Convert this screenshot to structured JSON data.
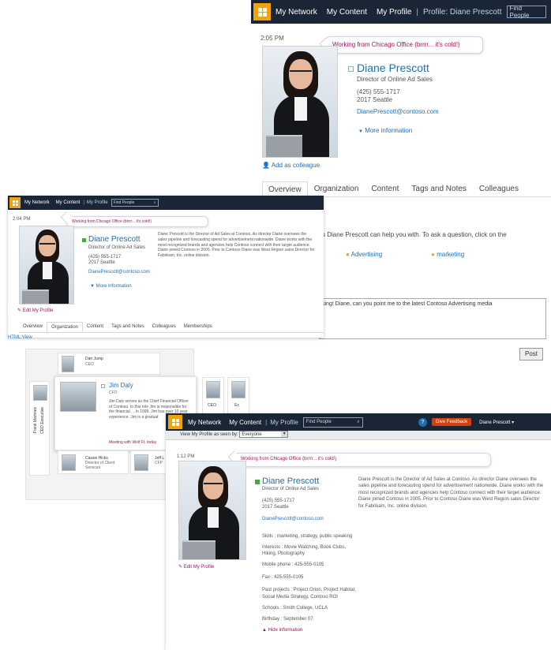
{
  "brand_colors": {
    "topbar": "#1a2636",
    "logo": "#f0a30a",
    "link": "#1e6fb5",
    "status": "#a3125a",
    "feedback": "#d5400f"
  },
  "win1": {
    "nav": {
      "my_network": "My Network",
      "my_content": "My Content",
      "my_profile": "My Profile",
      "sep": "|",
      "profile_crumb": "Profile: Diane Prescott",
      "find": "Find People"
    },
    "time": "2:05 PM",
    "status": "Working from Chicago Office (brrrr... it's cold!)",
    "name": "Diane Prescott",
    "title": "Director of Online Ad Sales",
    "phone": "(425) 555-1717",
    "office": "2017 Seattle",
    "email": "DianePrescott@contoso.com",
    "more": "More information",
    "add_colleague": "Add as colleague",
    "tabs": [
      "Overview",
      "Organization",
      "Content",
      "Tags and Notes",
      "Colleagues"
    ],
    "ask_text": "s Diane Prescott can help you with. To ask a question, click on the",
    "tags": [
      "Advertising",
      "marketing"
    ],
    "comment": "sing! Diane, can you point me to the latest Contoso Advertising media",
    "post": "Post"
  },
  "win2": {
    "nav": {
      "my_network": "My Network",
      "my_content": "My Content",
      "sep": "|",
      "my_profile": "My Profile",
      "find": "Find People"
    },
    "time": "2:04 PM",
    "status": "Working from Chicago Office (brrrr... it's cold!)",
    "name": "Diane Prescott",
    "title": "Director of Online Ad Sales",
    "phone": "(425) 555-1717",
    "office": "2017 Seattle",
    "email": "DianePrescott@contoso.com",
    "more": "More information",
    "bio": "Diane Prescott is the Director of Ad Sales at Contoso. As director Diane oversees the sales pipeline and forecasting spend for advertisement nationwide. Diane works with the most recognized brands and agencies help Contoso connect with their target audience. Diane joined Contoso in 2005. Prior to Contoso Diane was West Region sales Director for Fabrikam, Inc. online division.",
    "edit": "Edit My Profile",
    "tabs": [
      "Overview",
      "Organization",
      "Content",
      "Tags and Notes",
      "Colleagues",
      "Memberships"
    ],
    "html_view": "HTML View"
  },
  "org": {
    "top": {
      "name": "Dan Jump",
      "role": "CEO"
    },
    "main": {
      "name": "Jim Daly",
      "role": "CFO",
      "bio": "Jim Daly serves as the Chief Financial Officer of Contoso. In this role Jim is responsible for the financial ... In 1999. Jim has over 10 year experience. Jim is a graduat",
      "meeting": "Meeting with Wolf Ft. today"
    },
    "side_left": {
      "name": "Frank Martinez",
      "role": "CEO Executive"
    },
    "reports": [
      {
        "name": "Cassie Hicks",
        "role": "Director of Client Services"
      },
      {
        "name": "Jeff L",
        "role": "CFP"
      }
    ],
    "side_right_labels": [
      "CEO",
      "Ex"
    ]
  },
  "win3": {
    "nav": {
      "my_network": "My Network",
      "my_content": "My Content",
      "sep": "|",
      "my_profile": "My Profile",
      "find": "Find People",
      "feedback": "Give Feedback",
      "user": "Diane Prescott"
    },
    "view_as_label": "View My Profile as seen by:",
    "view_as_value": "Everyone",
    "time": "1:12 PM",
    "status": "Working from Chicago Office (brrrr... it's cold!)",
    "name": "Diane Prescott",
    "title": "Director of Online Ad Sales",
    "phone": "(425) 555-1717",
    "office": "2017 Seattle",
    "email": "DianePrescott@contoso.com",
    "bio": "Diane Prescott is the Director of Ad Sales at Contoso. As director Diane oversees the sales pipeline and forecasting spend for advertisement nationwide. Diane works with the most recognized brands and agencies help Contoso connect with their target audience. Diane joined Contoso in 2005. Prior to Contoso Diane was West Region sales Director for Fabrikam, Inc. online division.",
    "skills": "Skills : marketing, strategy, public speaking",
    "interests": "Interests : Movie Watching, Book Clubs, Hiking, Photography",
    "mobile": "Mobile phone : 425-555-0105",
    "fax": "Fax : 425-555-0105",
    "projects": "Past projects : Project Orion, Project Habitat, Social Media Strategy, Contoso ROI",
    "schools": "Schools : Smith College, UCLA",
    "birthday": "Birthday : September 07",
    "hide": "Hide information",
    "edit": "Edit My Profile"
  }
}
